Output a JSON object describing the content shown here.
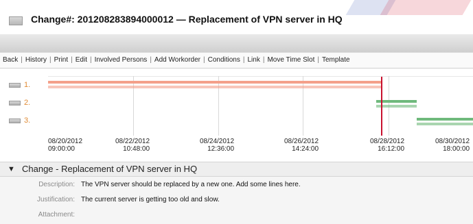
{
  "header": {
    "title": "Change#: 201208283894000012 — Replacement of VPN server in HQ"
  },
  "menu": {
    "items": [
      "Back",
      "History",
      "Print",
      "Edit",
      "Involved Persons",
      "Add Workorder",
      "Conditions",
      "Link",
      "Move Time Slot",
      "Template"
    ]
  },
  "gantt": {
    "rows": [
      "1.",
      "2.",
      "3."
    ],
    "ticks": [
      {
        "date": "08/20/2012",
        "time": "09:00:00"
      },
      {
        "date": "08/22/2012",
        "time": "10:48:00"
      },
      {
        "date": "08/24/2012",
        "time": "12:36:00"
      },
      {
        "date": "08/26/2012",
        "time": "14:24:00"
      },
      {
        "date": "08/28/2012",
        "time": "16:12:00"
      },
      {
        "date": "08/30/2012",
        "time": "18:00:00"
      }
    ],
    "colors": {
      "row1": "#f4a08a",
      "row2": "#6fb97c",
      "row3": "#6fb97c",
      "now": "#c8102e"
    }
  },
  "section": {
    "title": "Change - Replacement of VPN server in HQ",
    "fields": [
      {
        "label": "Description:",
        "value": "The VPN server should be replaced by a new one. Add some lines here."
      },
      {
        "label": "Justification:",
        "value": "The current server is getting too old and slow."
      },
      {
        "label": "Attachment:",
        "value": ""
      }
    ]
  }
}
